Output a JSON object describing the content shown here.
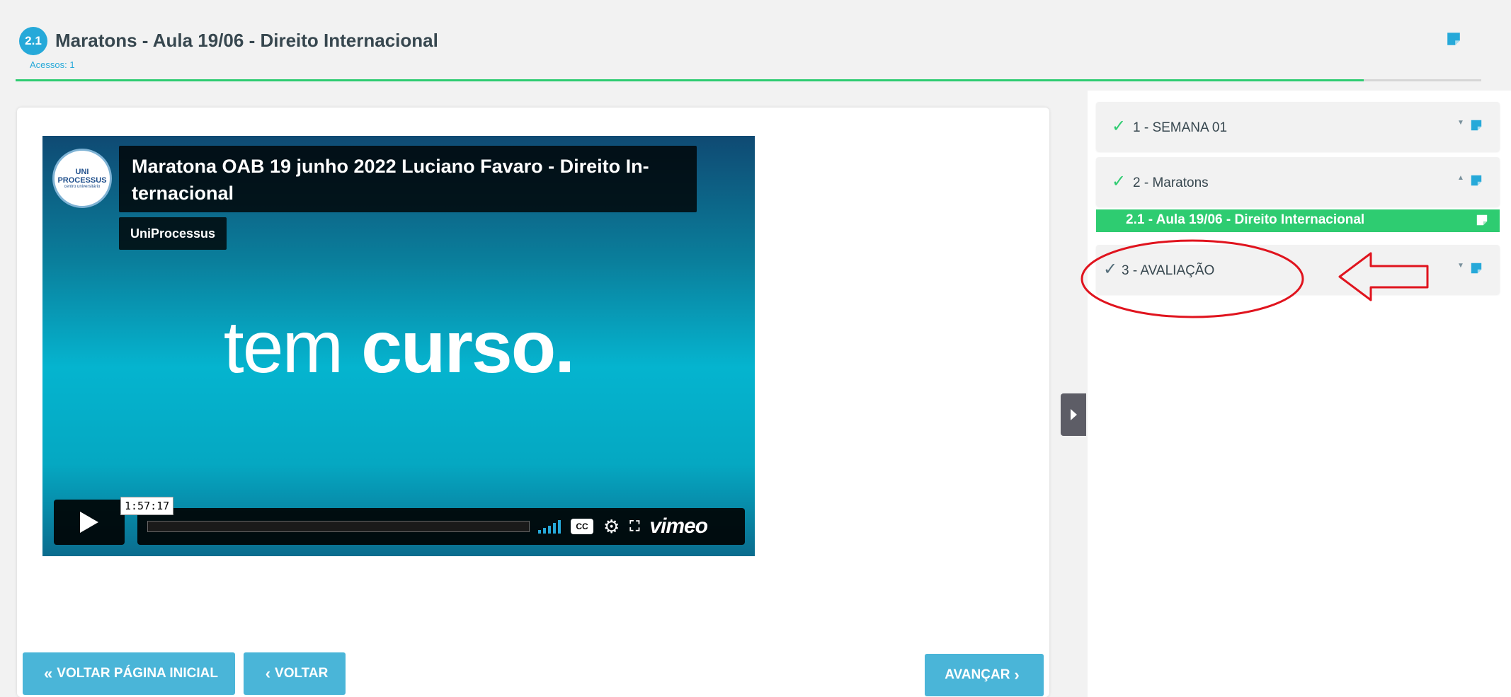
{
  "header": {
    "badge": "2.1",
    "title": "Maratons - Aula 19/06 - Direito Internacional",
    "access_count": "Acessos: 1",
    "progress_fraction": 0.92
  },
  "video": {
    "title": "Maratona OAB 19 junho 2022 Luciano Favaro - Direito In-ternacional",
    "channel": "UniProcessus",
    "logo_line1": "UNI",
    "logo_line2": "PROCESSUS",
    "logo_line3": "centro universitário",
    "hero_word1": "tem",
    "hero_word2": "curso.",
    "time_tooltip": "1:57:17",
    "cc_label": "CC",
    "brand": "vimeo"
  },
  "buttons": {
    "home_label": "VOLTAR PÁGINA INICIAL",
    "back_label": "VOLTAR",
    "next_label": "AVANÇAR"
  },
  "sidebar": {
    "modules": [
      {
        "label": "1 - SEMANA 01",
        "completed": true,
        "expanded": false
      },
      {
        "label": "2 - Maratons",
        "completed": true,
        "expanded": true
      },
      {
        "label": "3 - AVALIAÇÃO",
        "completed": true,
        "expanded": false
      }
    ],
    "active_lesson": "2.1 - Aula 19/06 - Direito Internacional"
  },
  "colors": {
    "accent": "#26a9d9",
    "button": "#4ab5d8",
    "success": "#2ecc71",
    "annotation": "#e0141e"
  },
  "icons": {
    "note": "sticky-note-icon",
    "check": "check-icon",
    "play": "play-icon",
    "settings": "gear-icon",
    "fullscreen": "fullscreen-icon",
    "caret_down": "caret-down-icon",
    "caret_up": "caret-up-icon"
  }
}
